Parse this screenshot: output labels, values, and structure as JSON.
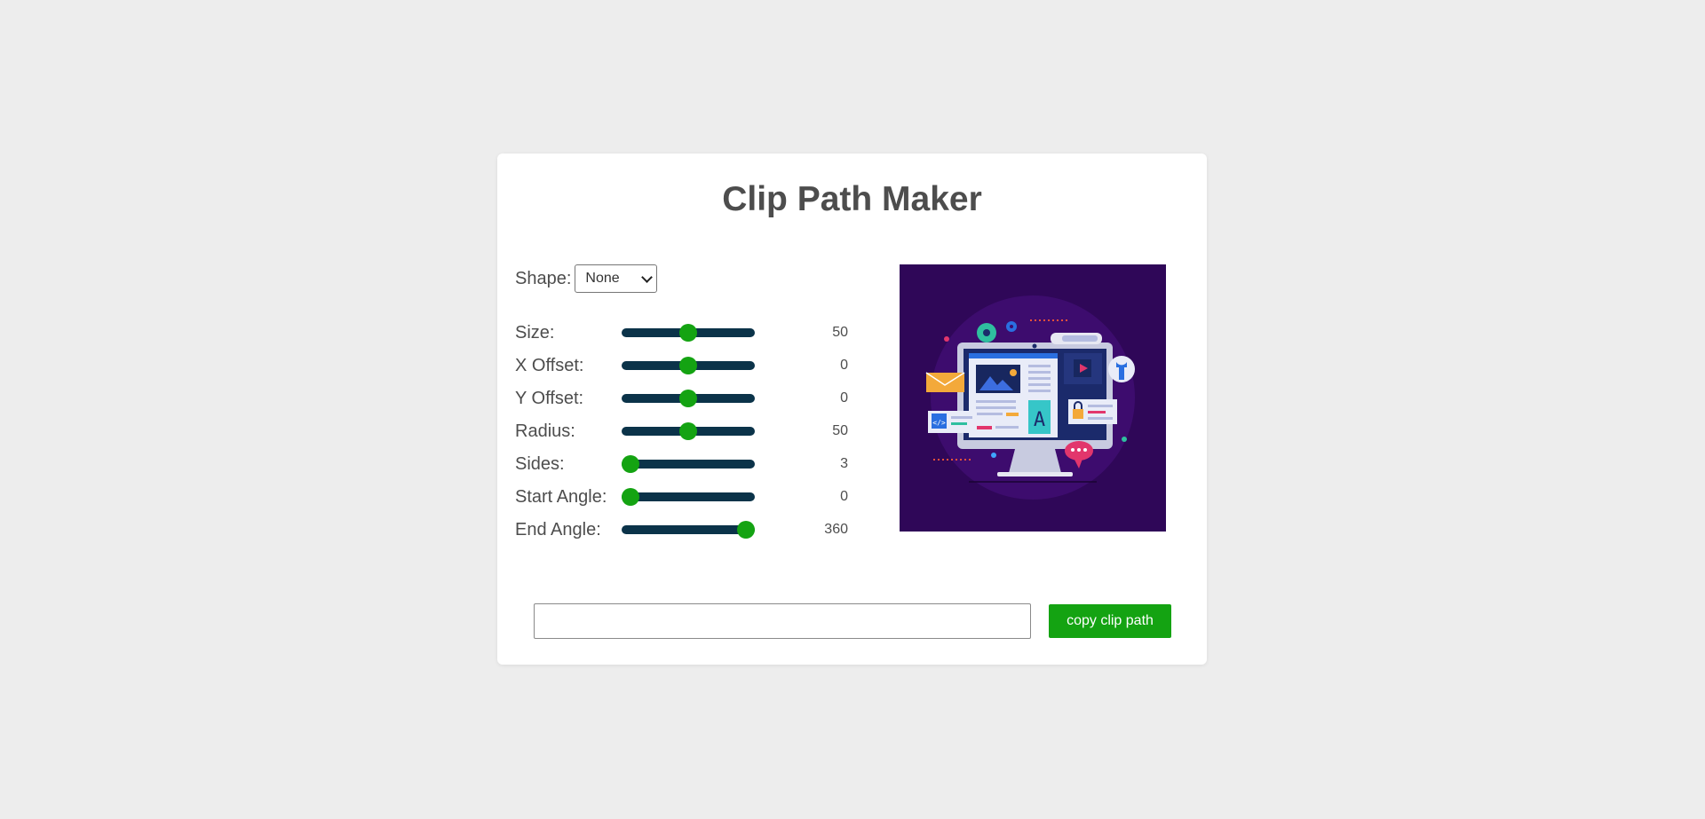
{
  "title": "Clip Path Maker",
  "shape": {
    "label": "Shape:",
    "selected": "None"
  },
  "sliders": [
    {
      "label": "Size:",
      "value": "50",
      "fraction": 0.5
    },
    {
      "label": "X Offset:",
      "value": "0",
      "fraction": 0.5
    },
    {
      "label": "Y Offset:",
      "value": "0",
      "fraction": 0.5
    },
    {
      "label": "Radius:",
      "value": "50",
      "fraction": 0.5
    },
    {
      "label": "Sides:",
      "value": "3",
      "fraction": 0.0
    },
    {
      "label": "Start Angle:",
      "value": "0",
      "fraction": 0.0
    },
    {
      "label": "End Angle:",
      "value": "360",
      "fraction": 1.0
    }
  ],
  "output": {
    "value": ""
  },
  "copy_button": "copy clip path",
  "colors": {
    "accent": "#14a312",
    "track": "#0b3349",
    "preview_bg": "#2f0758"
  }
}
